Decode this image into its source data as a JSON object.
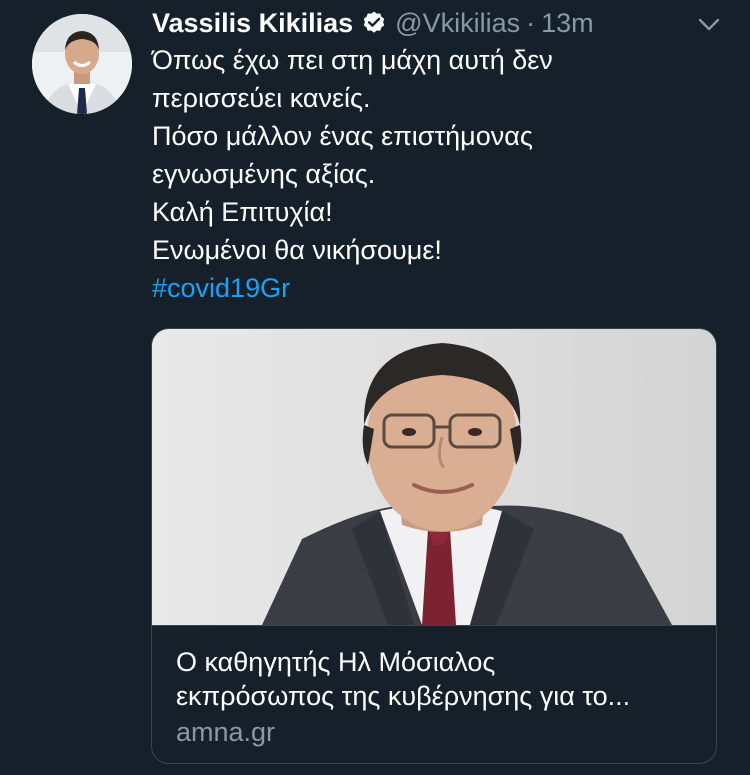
{
  "tweet": {
    "author_name": "Vassilis Kikilias",
    "handle": "@Vkikilias",
    "separator": "·",
    "time": "13m",
    "lines": [
      "Όπως έχω πει στη μάχη αυτή δεν",
      "περισσεύει κανείς.",
      "Πόσο μάλλον ένας επιστήμονας",
      "εγνωσμένης αξίας.",
      "Καλή Επιτυχία!",
      "Ενωμένοι θα νικήσουμε!"
    ],
    "hashtag": "#covid19Gr"
  },
  "link_card": {
    "title_line1": "Ο καθηγητής Ηλ Μόσιαλος",
    "title_line2": "εκπρόσωπος της κυβέρνησης για το...",
    "domain": "amna.gr"
  },
  "icons": {
    "verified": "verified-badge-icon",
    "caret": "chevron-down-icon"
  },
  "colors": {
    "background": "#15202b",
    "text": "#ffffff",
    "secondary": "#8899a6",
    "link": "#1da1f2",
    "border": "#38444d"
  }
}
